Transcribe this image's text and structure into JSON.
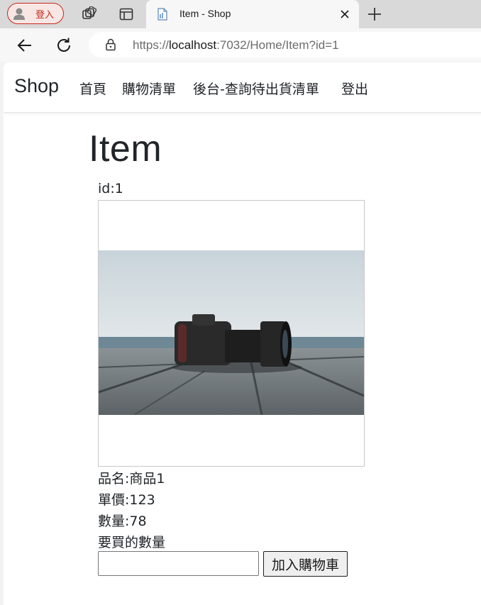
{
  "browser": {
    "profile_label": "登入",
    "tab_title": "Item - Shop",
    "url_prefix": "https://",
    "url_host": "localhost",
    "url_rest": ":7032/Home/Item?id=1"
  },
  "site": {
    "brand": "Shop",
    "nav": [
      "首頁",
      "購物清單",
      "後台-查詢待出貨清單",
      "登出"
    ]
  },
  "item": {
    "page_title": "Item",
    "id_text": "id:1",
    "name_text": "品名:商品1",
    "price_text": "單價:123",
    "stock_text": "數量:78",
    "buy_qty_label": "要買的數量",
    "buy_qty_value": "",
    "add_to_cart_label": "加入購物車",
    "image_subject": "camera-photo"
  },
  "colors": {
    "profile_accent": "#c42b1c",
    "text": "#212529"
  }
}
